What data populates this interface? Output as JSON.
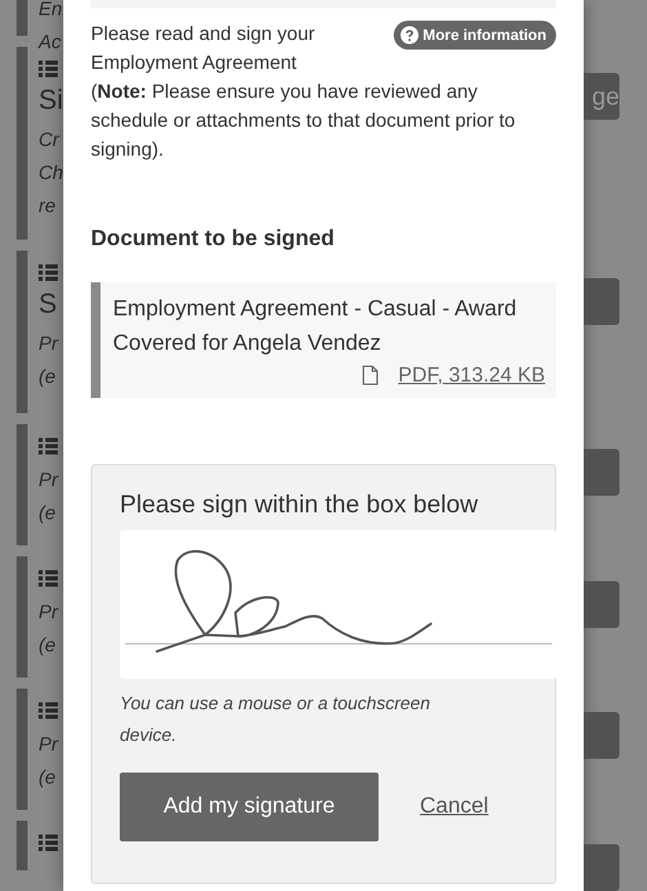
{
  "background_cards": [
    {
      "lines": [
        "En",
        "Ac"
      ]
    },
    {
      "title": "Si",
      "lines": [
        "Cr",
        "Ch",
        "re"
      ],
      "button": "ge"
    },
    {
      "title": "S",
      "lines": [
        "Pr",
        "(e"
      ],
      "has_button": true
    },
    {
      "lines": [
        "Pr",
        "(e"
      ],
      "has_button": true
    },
    {
      "lines": [
        "Pr",
        "(e"
      ],
      "has_button": true
    },
    {
      "lines": [
        "Pr",
        "(e"
      ],
      "has_button": true
    },
    {
      "has_button": true
    }
  ],
  "modal": {
    "intro": "Please read and sign your Employment Agreement",
    "note": "(**Note:** Please ensure you have reviewed any schedule or attachments to that document prior to signing).",
    "more_info_button": "More information",
    "document_heading": "Document to be signed",
    "document": {
      "title": "Employment Agreement - Casual - Award Covered for Angela Vendez",
      "file_link": "PDF, 313.24 KB"
    },
    "signature": {
      "heading": "Please sign within the box below",
      "hint": "You can use a mouse or a touchscreen device.",
      "submit_button": "Add my signature",
      "cancel_link": "Cancel"
    }
  }
}
